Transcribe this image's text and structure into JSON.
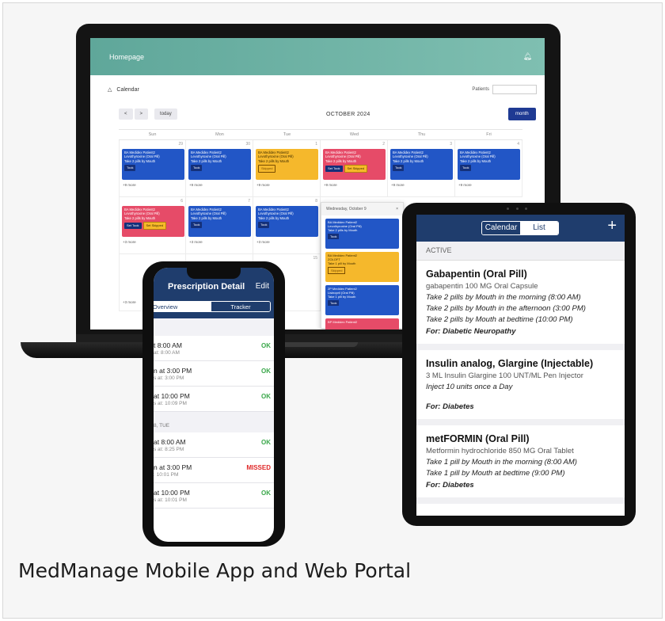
{
  "caption": "MedManage Mobile App and Web Portal",
  "laptop": {
    "header_title": "Homepage",
    "calendar_title": "Calendar",
    "patients_label": "Patients",
    "nav": {
      "prev": "<",
      "next": ">",
      "today": "today"
    },
    "month_title": "OCTOBER 2024",
    "view_button": "month",
    "weekdays": [
      "Sun",
      "Mon",
      "Tue",
      "Wed",
      "Thu",
      "Fri"
    ],
    "week1": {
      "dates": [
        "29",
        "30",
        "1",
        "2",
        "3",
        "4"
      ],
      "events": [
        {
          "color": "blue",
          "l1": "BA Medidex Patient2",
          "l2": "Levothyroxine (Oral Pill)",
          "l3": "Take 2 pills by Mouth",
          "tags": [
            "Took"
          ]
        },
        {
          "color": "blue",
          "l1": "BA Medidex Patient2",
          "l2": "Levothyroxine (Oral Pill)",
          "l3": "Take 2 pills by Mouth",
          "tags": [
            "Took"
          ]
        },
        {
          "color": "yellow",
          "l1": "BA Medidex Patient2",
          "l2": "Levothyroxine (Oral Pill)",
          "l3": "Take 2 pills by Mouth",
          "tags": [
            "Skipped"
          ]
        },
        {
          "color": "red",
          "l1": "BA Medidex Patient2",
          "l2": "Levothyroxine (Oral Pill)",
          "l3": "Take 2 pills by Mouth",
          "tags": [
            "Set Took",
            "Set Skipped"
          ]
        },
        {
          "color": "blue",
          "l1": "BA Medidex Patient2",
          "l2": "Levothyroxine (Oral Pill)",
          "l3": "Take 2 pills by Mouth",
          "tags": [
            "Took"
          ]
        },
        {
          "color": "blue",
          "l1": "BA Medidex Patient2",
          "l2": "Levothyroxine (Oral Pill)",
          "l3": "Take 2 pills by Mouth",
          "tags": [
            "Took"
          ]
        }
      ],
      "more": [
        "+9 more",
        "+9 more",
        "+9 more",
        "+9 more",
        "+9 more",
        "+9 more"
      ]
    },
    "week2": {
      "dates": [
        "6",
        "7",
        "8"
      ],
      "events": [
        {
          "color": "red",
          "l1": "BA Medidex Patient2",
          "l2": "Levothyroxine (Oral Pill)",
          "l3": "Take 2 pills by Mouth",
          "tags": [
            "Set Took",
            "Set Skipped"
          ]
        },
        {
          "color": "blue",
          "l1": "BA Medidex Patient2",
          "l2": "Levothyroxine (Oral Pill)",
          "l3": "Take 2 pills by Mouth",
          "tags": [
            "Took"
          ]
        },
        {
          "color": "blue",
          "l1": "BA Medidex Patient2",
          "l2": "Levothyroxine (Oral Pill)",
          "l3": "Take 2 pills by Mouth",
          "tags": [
            "Took"
          ]
        }
      ],
      "more": [
        "+3 more",
        "+3 more",
        "+3 more"
      ]
    },
    "week3": {
      "dates": [
        "15"
      ],
      "more": [
        "+3 more"
      ]
    },
    "popup": {
      "title": "Wednesday, October 9",
      "close": "×",
      "events": [
        {
          "color": "blue",
          "l1": "BA Medidex Patient2",
          "l2": "Levothyroxine (Oral Pill)",
          "l3": "Take 2 pills by Mouth",
          "tag": "Took"
        },
        {
          "color": "yellow",
          "l1": "BA Medidex Patient2",
          "l2": "ZOLOFT",
          "l3": "Take 1 pill by Mouth",
          "tag": "Skipped"
        },
        {
          "color": "blue",
          "l1": "2P Medidex Patient2",
          "l2": "Lisinopril (Oral Pill)",
          "l3": "Take 1 pill by Mouth",
          "tag": "Took"
        },
        {
          "color": "red",
          "l1": "BP Medidex Patient2",
          "l2": "",
          "l3": "",
          "tag": ""
        }
      ]
    }
  },
  "phone": {
    "title": "Prescription Detail",
    "edit": "Edit",
    "tabs": [
      "Overview",
      "Tracker"
    ],
    "rows1": [
      {
        "main": "t 8:00 AM",
        "sub": "at: 8:00 AM",
        "status": "OK"
      },
      {
        "main": "n at 3:00 PM",
        "sub": "s at: 3:00 PM",
        "status": "OK"
      },
      {
        "main": "at 10:00 PM",
        "sub": "s at: 10:09 PM",
        "status": "OK"
      }
    ],
    "section2": "8, TUE",
    "rows2": [
      {
        "main": "at 8:00 AM",
        "sub": "s at: 8:25 PM",
        "status": "OK"
      },
      {
        "main": "n at 3:00 PM",
        "sub": ": 10:01 PM",
        "status": "MISSED"
      },
      {
        "main": "at 10:00 PM",
        "sub": "s at: 10:01 PM",
        "status": "OK"
      }
    ]
  },
  "tablet": {
    "tabs": [
      "Calendar",
      "List"
    ],
    "add": "+",
    "section": "ACTIVE",
    "meds": [
      {
        "name": "Gabapentin (Oral Pill)",
        "desc": "gabapentin 100 MG Oral Capsule",
        "instructions": [
          "Take 2 pills by Mouth in the morning (8:00 AM)",
          "Take 2 pills by Mouth in the afternoon (3:00 PM)",
          "Take 2 pills by Mouth at bedtime (10:00 PM)"
        ],
        "for": "For: Diabetic Neuropathy"
      },
      {
        "name": "Insulin analog, Glargine (Injectable)",
        "desc": "3 ML Insulin Glargine 100 UNT/ML Pen Injector",
        "instructions": [
          "Inject 10 units once a Day"
        ],
        "for": "For: Diabetes"
      },
      {
        "name": "metFORMIN (Oral Pill)",
        "desc": "Metformin hydrochloride 850 MG Oral Tablet",
        "instructions": [
          "Take 1 pill by Mouth in the morning (8:00 AM)",
          "Take 1 pill by Mouth at bedtime (9:00 PM)"
        ],
        "for": "For: Diabetes"
      }
    ]
  }
}
